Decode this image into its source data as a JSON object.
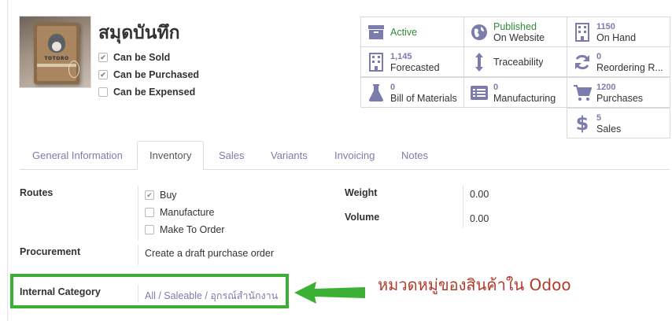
{
  "product": {
    "name": "สมุดบันทึก",
    "image_caption": "TOTORO",
    "checkboxes": [
      {
        "label": "Can be Sold",
        "checked": true
      },
      {
        "label": "Can be Purchased",
        "checked": true
      },
      {
        "label": "Can be Expensed",
        "checked": false
      }
    ]
  },
  "smart_buttons": {
    "active": {
      "label": "Active",
      "icon": "archive-icon"
    },
    "website": {
      "value": "Published",
      "label": "On Website",
      "icon": "globe-icon"
    },
    "on_hand": {
      "value": "1150",
      "label": "On Hand",
      "icon": "building-icon"
    },
    "forecasted": {
      "value": "1,145",
      "label": "Forecasted",
      "icon": "building-icon"
    },
    "traceability": {
      "label": "Traceability",
      "icon": "arrows-vertical-icon"
    },
    "reordering": {
      "value": "0",
      "label": "Reordering R...",
      "icon": "refresh-icon"
    },
    "bom": {
      "value": "0",
      "label": "Bill of Materials",
      "icon": "flask-icon"
    },
    "manufacturing": {
      "value": "0",
      "label": "Manufacturing",
      "icon": "list-icon"
    },
    "purchases": {
      "value": "1200",
      "label": "Purchases",
      "icon": "cart-icon"
    },
    "sales": {
      "value": "5",
      "label": "Sales",
      "icon": "dollar-icon"
    }
  },
  "tabs": [
    {
      "label": "General Information",
      "active": false
    },
    {
      "label": "Inventory",
      "active": true
    },
    {
      "label": "Sales",
      "active": false
    },
    {
      "label": "Variants",
      "active": false
    },
    {
      "label": "Invoicing",
      "active": false
    },
    {
      "label": "Notes",
      "active": false
    }
  ],
  "inventory": {
    "routes_label": "Routes",
    "routes": [
      {
        "label": "Buy",
        "checked": true
      },
      {
        "label": "Manufacture",
        "checked": false
      },
      {
        "label": "Make To Order",
        "checked": false
      }
    ],
    "procurement_label": "Procurement",
    "procurement_value": "Create a draft purchase order",
    "internal_category_label": "Internal Category",
    "internal_category_value": "All / Saleable / อุกรณ์สำนักงาน",
    "weight_label": "Weight",
    "weight_value": "0.00",
    "volume_label": "Volume",
    "volume_value": "0.00"
  },
  "annotation": {
    "text": "หมวดหมู่ของสินค้าใน Odoo",
    "color": "#b33a2a",
    "box_color": "#3cb034"
  },
  "colors": {
    "accent": "#7c7bad",
    "active_green": "#2e8b3a"
  }
}
